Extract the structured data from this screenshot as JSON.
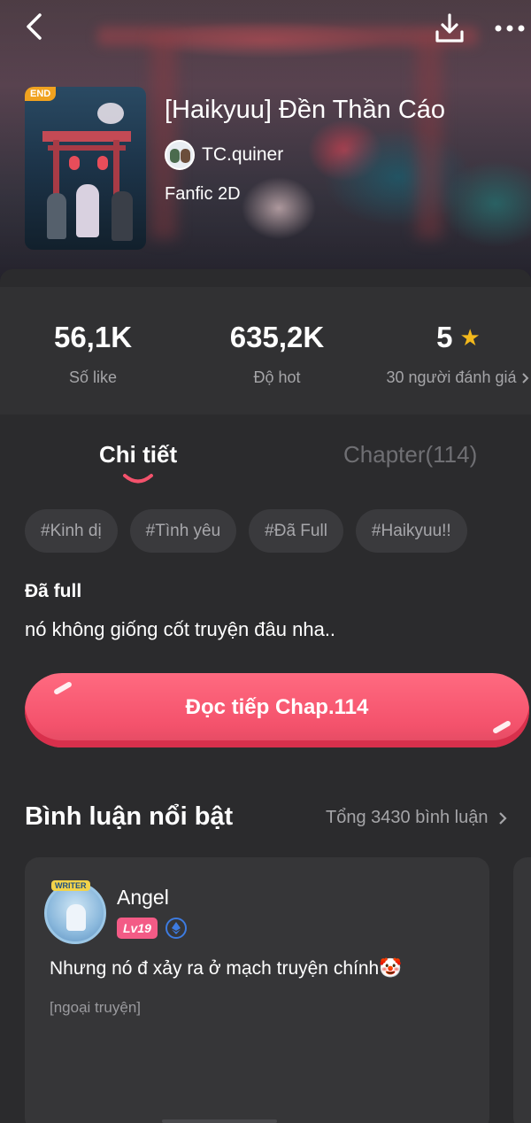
{
  "header": {
    "end_badge": "END",
    "title": "[Haikyuu] Đền Thần Cáo",
    "author": "TC.quiner",
    "genre": "Fanfic 2D"
  },
  "stats": {
    "likes": {
      "value": "56,1K",
      "label": "Số like"
    },
    "hot": {
      "value": "635,2K",
      "label": "Độ hot"
    },
    "rating": {
      "value": "5",
      "label": "30 người đánh giá"
    }
  },
  "tabs": {
    "detail": "Chi tiết",
    "chapter": "Chapter(114)"
  },
  "tags": [
    "#Kinh dị",
    "#Tình yêu",
    "#Đã Full",
    "#Haikyuu!!"
  ],
  "status": "Đã full",
  "description": "nó không giống cốt truyện đâu nha..",
  "read_button": "Đọc tiếp Chap.114",
  "comments": {
    "heading": "Bình luận nổi bật",
    "total": "Tổng 3430 bình luận",
    "items": [
      {
        "avatar_tag": "WRITER",
        "name": "Angel",
        "level": "Lv19",
        "text": "Nhưng nó đ xảy ra ở mạch truyện chính🤡",
        "sub": "[ngoại truyện]"
      }
    ]
  },
  "colors": {
    "accent": "#f4526c",
    "star": "#f2b81c",
    "background": "#2b2b2d"
  }
}
